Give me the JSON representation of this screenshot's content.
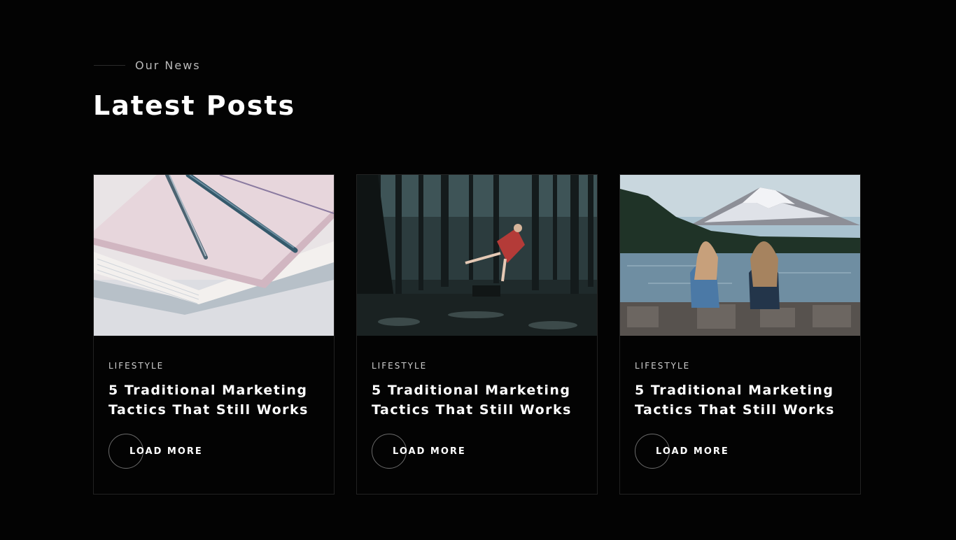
{
  "section": {
    "eyebrow": "Our News",
    "heading": "Latest Posts"
  },
  "posts": [
    {
      "category": "LIFESTYLE",
      "title": "5 Traditional Marketing Tactics That Still Works",
      "cta": "LOAD MORE",
      "image": "notebooks-and-pencils-photo"
    },
    {
      "category": "LIFESTYLE",
      "title": "5 Traditional Marketing Tactics That Still Works",
      "cta": "LOAD MORE",
      "image": "woman-levitating-in-forest-photo"
    },
    {
      "category": "LIFESTYLE",
      "title": "5 Traditional Marketing Tactics That Still Works",
      "cta": "LOAD MORE",
      "image": "two-women-by-mountain-lake-photo"
    }
  ],
  "colors": {
    "background": "#030303",
    "card_border": "#222222",
    "text_primary": "#ffffff",
    "text_muted": "#b9b9b9"
  }
}
